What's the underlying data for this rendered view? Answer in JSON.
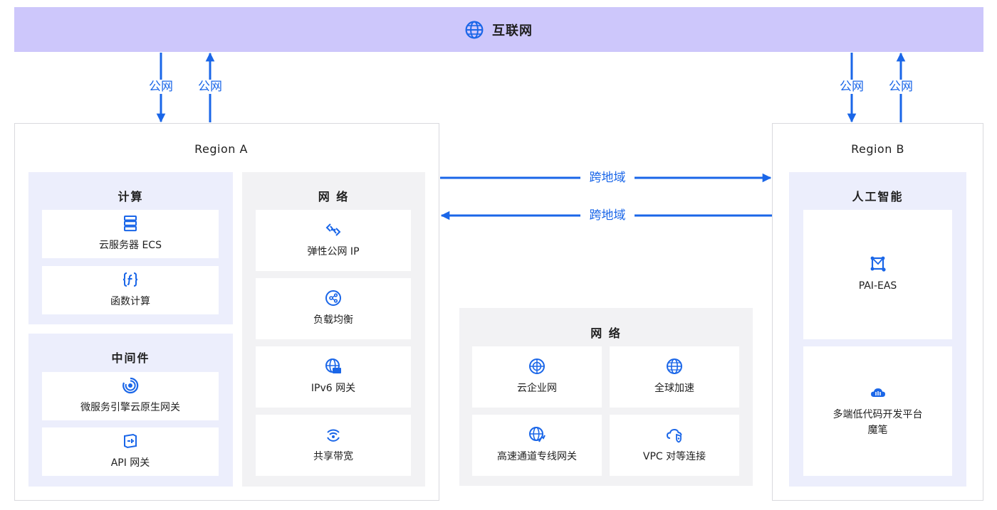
{
  "internet": {
    "label": "互联网",
    "icon": "globe-icon"
  },
  "public_label": "公网",
  "cross_region_label": "跨地域",
  "colors": {
    "accent": "#1a66e8",
    "internet_bar": "#cdc7fb",
    "panel_blue": "#eceefc",
    "panel_gray": "#f2f2f4"
  },
  "region_a": {
    "title": "Region A",
    "compute": {
      "title": "计算",
      "items": [
        {
          "label": "云服务器 ECS",
          "icon": "server-icon"
        },
        {
          "label": "函数计算",
          "icon": "function-icon"
        }
      ]
    },
    "middleware": {
      "title": "中间件",
      "items": [
        {
          "label": "微服务引擎云原生网关",
          "icon": "microservice-engine-icon"
        },
        {
          "label": "API 网关",
          "icon": "api-gateway-icon"
        }
      ]
    },
    "network": {
      "title": "网 络",
      "items": [
        {
          "label": "弹性公网 IP",
          "icon": "eip-icon"
        },
        {
          "label": "负载均衡",
          "icon": "load-balancer-icon"
        },
        {
          "label": "IPv6 网关",
          "icon": "ipv6-gateway-icon"
        },
        {
          "label": "共享带宽",
          "icon": "shared-bandwidth-icon"
        }
      ]
    }
  },
  "center_network": {
    "title": "网 络",
    "items": [
      {
        "label": "云企业网",
        "icon": "cen-icon"
      },
      {
        "label": "全球加速",
        "icon": "global-acceleration-icon"
      },
      {
        "label": "高速通道专线网关",
        "icon": "express-connect-icon"
      },
      {
        "label": "VPC 对等连接",
        "icon": "vpc-peering-icon"
      }
    ]
  },
  "region_b": {
    "title": "Region B",
    "ai": {
      "title": "人工智能",
      "items": [
        {
          "label": "PAI-EAS",
          "icon": "pai-eas-icon"
        },
        {
          "label_lines": [
            "多端低代码开发平台",
            "魔笔"
          ],
          "icon": "cloud-platform-icon"
        }
      ]
    }
  }
}
